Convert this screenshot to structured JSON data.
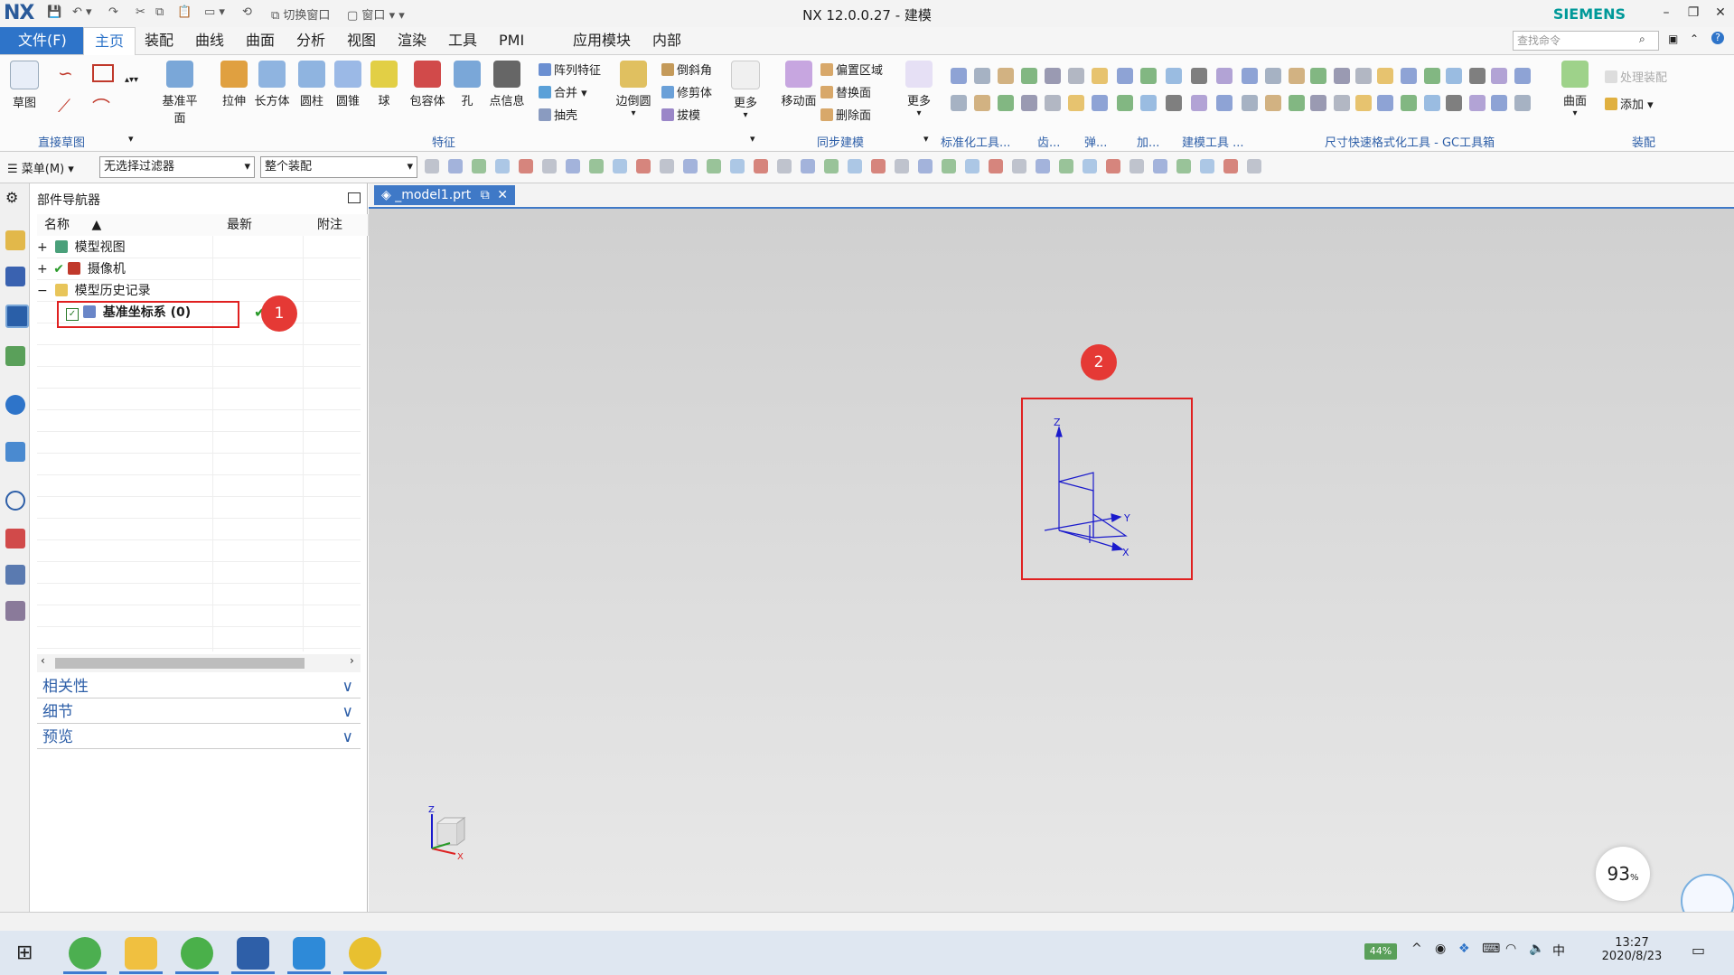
{
  "titlebar": {
    "logo": "NX",
    "switch_window": "切换窗口",
    "window_menu": "窗口",
    "title": "NX 12.0.0.27 - 建模",
    "brand": "SIEMENS"
  },
  "menu": {
    "file": "文件(F)",
    "tabs": [
      "主页",
      "装配",
      "曲线",
      "曲面",
      "分析",
      "视图",
      "渲染",
      "工具",
      "PMI",
      "应用模块",
      "内部"
    ],
    "active_tab": "主页",
    "search_placeholder": "查找命令"
  },
  "ribbon": {
    "sketch": {
      "label": "草图",
      "group": "直接草图"
    },
    "features": [
      {
        "label": "基准平面",
        "color": "#7aa7d8"
      },
      {
        "label": "拉伸",
        "color": "#e0a040"
      },
      {
        "label": "长方体",
        "color": "#8fb4e0"
      },
      {
        "label": "圆柱",
        "color": "#8fb4e0"
      },
      {
        "label": "圆锥",
        "color": "#9bb9e6"
      },
      {
        "label": "球",
        "color": "#e2cf45"
      },
      {
        "label": "包容体",
        "color": "#d14a4a"
      },
      {
        "label": "孔",
        "color": "#7aa7d8"
      },
      {
        "label": "点信息",
        "color": "#666666"
      }
    ],
    "feature_small": [
      "阵列特征",
      "合并",
      "抽壳"
    ],
    "edge_blend": "边倒圆",
    "feature_small2": [
      "倒斜角",
      "修剪体",
      "拔模"
    ],
    "more": "更多",
    "feature_group": "特征",
    "move_face": "移动面",
    "sync_small": [
      "偏置区域",
      "替换面",
      "删除面"
    ],
    "more2": "更多",
    "sync_group": "同步建模",
    "other_groups": [
      "标准化工具...",
      "齿...",
      "弹...",
      "加...",
      "建模工具 ...",
      "尺寸快速格式化工具 - GC工具箱",
      "装配"
    ],
    "curve_surface": "曲面",
    "add": "添加",
    "process_assembly": "处理装配"
  },
  "toolbar2": {
    "menu": "菜单(M)",
    "filter": "无选择过滤器",
    "scope": "整个装配"
  },
  "navigator": {
    "title": "部件导航器",
    "columns": [
      "名称",
      "最新",
      "附注"
    ],
    "rows": [
      "模型视图",
      "摄像机",
      "模型历史记录",
      "基准坐标系 (0)"
    ],
    "sections": [
      "相关性",
      "细节",
      "预览"
    ]
  },
  "viewport": {
    "tab": "_model1.prt",
    "axes": {
      "z": "Z",
      "y": "Y",
      "x": "X"
    },
    "markers": [
      "1",
      "2"
    ]
  },
  "indicator": {
    "value": "93",
    "unit": "%"
  },
  "taskbar": {
    "battery": "44%",
    "time": "13:27",
    "date": "2020/8/23"
  }
}
